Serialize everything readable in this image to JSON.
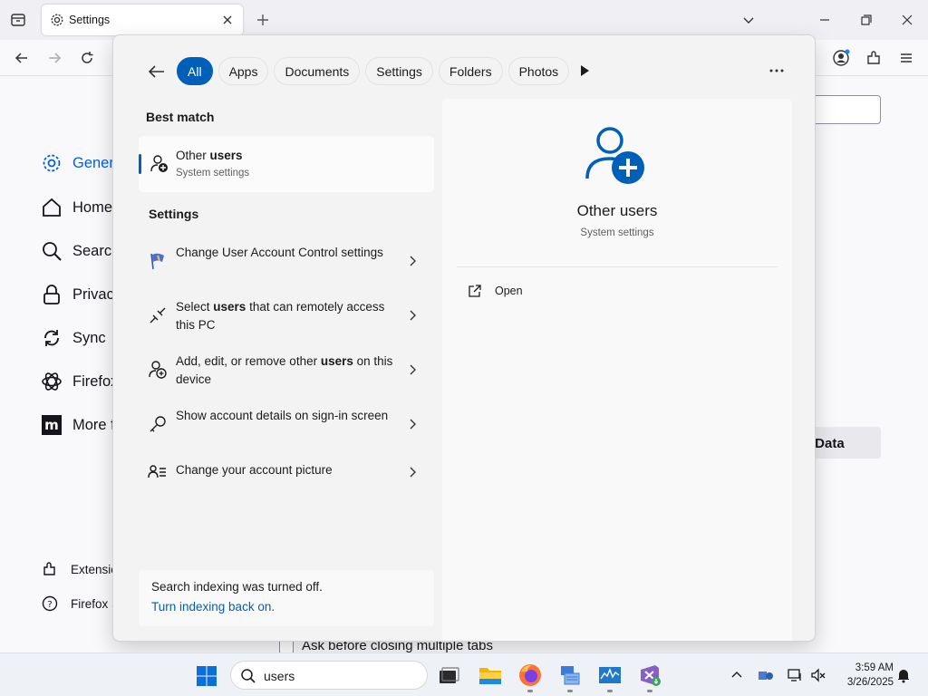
{
  "browser": {
    "tab": {
      "title": "Settings"
    },
    "sidebar": {
      "items": [
        {
          "label": "General",
          "active": true
        },
        {
          "label": "Home"
        },
        {
          "label": "Search"
        },
        {
          "label": "Privacy"
        },
        {
          "label": "Sync"
        },
        {
          "label": "Firefox"
        },
        {
          "label": "More f"
        }
      ],
      "footer": [
        {
          "label": "Extensio"
        },
        {
          "label": "Firefox S"
        }
      ]
    },
    "content": {
      "data_button_label": "t Data",
      "checkbox_label": "Ask before closing multiple tabs"
    }
  },
  "search": {
    "filters": [
      "All",
      "Apps",
      "Documents",
      "Settings",
      "Folders",
      "Photos"
    ],
    "active_filter": "All",
    "best_match": {
      "section_title": "Best match",
      "title_prefix": "Other ",
      "title_bold": "users",
      "subtitle": "System settings"
    },
    "settings_section": {
      "title": "Settings",
      "results": [
        {
          "pre": "Change User Account Control settings",
          "bold": "",
          "post": "",
          "icon": "uac-flag-icon"
        },
        {
          "pre": "Select ",
          "bold": "users",
          "post": " that can remotely access this PC",
          "icon": "remote-desktop-icon"
        },
        {
          "pre": "Add, edit, or remove other ",
          "bold": "users",
          "post": " on this device",
          "icon": "user-add-icon"
        },
        {
          "pre": "Show account details on sign-in screen",
          "bold": "",
          "post": "",
          "icon": "key-icon"
        },
        {
          "pre": "Change your account picture",
          "bold": "",
          "post": "",
          "icon": "account-picture-icon"
        }
      ]
    },
    "indexing": {
      "message": "Search indexing was turned off.",
      "link": "Turn indexing back on."
    },
    "preview": {
      "title": "Other users",
      "subtitle": "System settings",
      "action": "Open"
    }
  },
  "taskbar": {
    "search_text": "users",
    "time": "3:59 AM",
    "date": "3/26/2025"
  },
  "colors": {
    "accent": "#005fb8",
    "firefox_accent": "#0061e0"
  }
}
